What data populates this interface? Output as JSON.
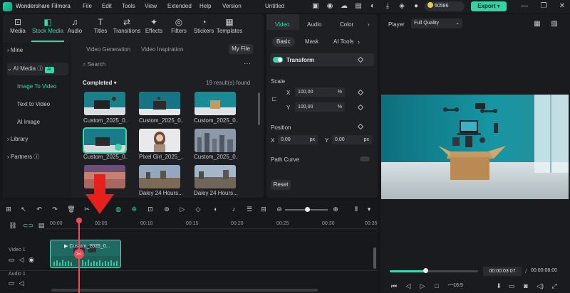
{
  "app": {
    "name": "Wondershare Filmora",
    "doc_title": "Untitled",
    "menu": [
      "File",
      "Edit",
      "Tools",
      "View",
      "Extended",
      "Help",
      "Version"
    ],
    "credits": "60586",
    "export_label": "Export"
  },
  "media_tabs": [
    {
      "label": "Media",
      "icon": "media-icon"
    },
    {
      "label": "Stock Media",
      "icon": "stock-media-icon"
    },
    {
      "label": "Audio",
      "icon": "audio-icon"
    },
    {
      "label": "Titles",
      "icon": "titles-icon"
    },
    {
      "label": "Transitions",
      "icon": "transitions-icon"
    },
    {
      "label": "Effects",
      "icon": "effects-icon"
    },
    {
      "label": "Filters",
      "icon": "filters-icon"
    },
    {
      "label": "Stickers",
      "icon": "stickers-icon"
    },
    {
      "label": "Templates",
      "icon": "templates-icon"
    }
  ],
  "sidebar": {
    "mine": "Mine",
    "ai_media": "AI Media",
    "ai_badge": "AI",
    "sub": [
      "Image To Video",
      "Text to Video",
      "AI Image"
    ],
    "library": "Library",
    "partners": "Partners"
  },
  "content": {
    "tabs": [
      "Video Generation",
      "Video Inspiration"
    ],
    "my_file": "My File",
    "search_placeholder": "Search",
    "completed": "Completed",
    "results": "19 result(s) found",
    "thumbs": [
      {
        "caption": "Custom_2025_0..."
      },
      {
        "caption": "Custom_2025_0..."
      },
      {
        "caption": "Custom_2025_0..."
      },
      {
        "caption": "Custom_2025_0..."
      },
      {
        "caption": "Pixel Girl_2025_..."
      },
      {
        "caption": "Custom_2025_0..."
      },
      {
        "caption": ""
      },
      {
        "caption": "Daley 24 Hours..."
      },
      {
        "caption": "Daley 24 Hours..."
      }
    ]
  },
  "properties": {
    "tabs": [
      "Video",
      "Audio",
      "Color"
    ],
    "subtabs": [
      "Basic",
      "Mask",
      "AI Tools"
    ],
    "transform": "Transform",
    "scale": "Scale",
    "x_label": "X",
    "y_label": "Y",
    "scale_x": "100,00",
    "scale_y": "100,00",
    "percent": "%",
    "position": "Position",
    "pos_x": "0,00",
    "pos_y": "0,00",
    "px": "px",
    "path_curve": "Path Curve",
    "reset": "Reset"
  },
  "player": {
    "label": "Player",
    "quality": "Full Quality",
    "current_time": "00:00:03:07",
    "separator": "/",
    "total_time": "00:00:08:00",
    "ratio": "16:9",
    "progress": 0.4
  },
  "timeline": {
    "ruler": [
      "00:00",
      "00:05",
      "00:10",
      "00:15",
      "00:20",
      "00:25",
      "00:30",
      "00:35"
    ],
    "video_track": "Video 1",
    "audio_track": "Audio 1",
    "clip_title": "Custom_2025_0..."
  },
  "colors": {
    "accent": "#3ad6ad",
    "playhead": "#f04b5a",
    "arrow": "#e8201c"
  }
}
